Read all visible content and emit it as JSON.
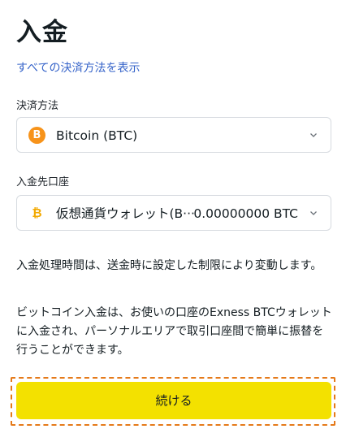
{
  "header": {
    "title": "入金",
    "all_methods_link": "すべての決済方法を表示"
  },
  "payment_method": {
    "label": "決済方法",
    "icon": "bitcoin-icon",
    "selected": "Bitcoin (BTC)"
  },
  "deposit_account": {
    "label": "入金先口座",
    "icon": "bitcoin-icon",
    "selected": "仮想通貨ウォレット(B···",
    "balance": "0.00000000 BTC"
  },
  "info": {
    "processing_time": "入金処理時間は、送金時に設定した制限により変動します。",
    "btc_note": "ビットコイン入金は、お使いの口座のExness BTCウォレットに入金され、パーソナルエリアで取引口座間で簡単に振替を行うことができます。"
  },
  "continue_button": {
    "label": "続ける"
  },
  "colors": {
    "accent_link": "#3563c9",
    "button_yellow": "#f3e100",
    "bitcoin_orange": "#f7931a",
    "highlight_outline": "#e57a1a"
  }
}
